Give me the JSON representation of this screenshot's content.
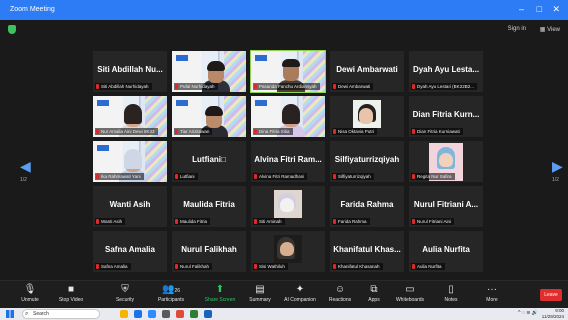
{
  "window": {
    "title": "Zoom Meeting",
    "minimize": "–",
    "maximize": "□",
    "close": "✕"
  },
  "topbar": {
    "sign_in": "Sign in",
    "view": "View"
  },
  "gallery": {
    "page_left": "1/2",
    "page_right": "1/2",
    "tiles": [
      {
        "name": "Siti Abdillah Nu...",
        "label": "Siti Abdillah Nurhidayah"
      },
      {
        "name": "",
        "label": "Pufal Nurhidayah"
      },
      {
        "name": "",
        "label": "Pasanda Fanchu Ardiansyah"
      },
      {
        "name": "Dewi Ambarwati",
        "label": "Dewi Ambarwati"
      },
      {
        "name": "Dyah Ayu Lesta...",
        "label": "Dyah Ayu Lestari (BK22B2..."
      },
      {
        "name": "",
        "label": "Nur Amalia Aini Dewi 8K33"
      },
      {
        "name": "",
        "label": "Tiar Arizitawan"
      },
      {
        "name": "",
        "label": "Dina Fitria Sitia"
      },
      {
        "name": "",
        "label": "Nisa Oktavia Putri"
      },
      {
        "name": "Dian Fitria Kurn...",
        "label": "Dian Fitria Kurniawati"
      },
      {
        "name": "",
        "label": "Ika Rahmawati Yani"
      },
      {
        "name": "Lutfiani□",
        "label": "Lutfiani"
      },
      {
        "name": "Alvina Fitri Ram...",
        "label": "Alvina Fitri Ramadhani"
      },
      {
        "name": "Silfiyaturrizqiyah",
        "label": "Silfiyaturrizqiyah"
      },
      {
        "name": "",
        "label": "Regita Nur Safira"
      },
      {
        "name": "Wanti Asih",
        "label": "Wanti Asih"
      },
      {
        "name": "Maulida Fitria",
        "label": "Maulida Fitria"
      },
      {
        "name": "",
        "label": "Siti Aminah"
      },
      {
        "name": "Farida Rahma",
        "label": "Farida Rahma"
      },
      {
        "name": "Nurul Fitriani A...",
        "label": "Nurul Fitriani Aini"
      },
      {
        "name": "Safna Amalia",
        "label": "Safna Amalia"
      },
      {
        "name": "Nurul Falikhah",
        "label": "Nurul Falikhah"
      },
      {
        "name": "",
        "label": "Sisi Wathiluh"
      },
      {
        "name": "Khanifatul Khas...",
        "label": "Khanifatul Khasanah"
      },
      {
        "name": "Aulia Nurfita",
        "label": "Aulia Nurfita"
      }
    ]
  },
  "toolbar": {
    "unmute": "Unmute",
    "stop_video": "Stop Video",
    "security": "Security",
    "participants": "Participants",
    "participants_count": "26",
    "share_screen": "Share Screen",
    "summary": "Summary",
    "ai_companion": "AI Companion",
    "reactions": "Reactions",
    "apps": "Apps",
    "whiteboards": "Whiteboards",
    "notes": "Notes",
    "more": "More",
    "leave": "Leave"
  },
  "taskbar": {
    "search_placeholder": "Search",
    "time": "9:00",
    "date": "11/29/2024"
  },
  "colors": {
    "accent": "#2d7cf6",
    "share": "#28c860",
    "leave": "#e02d2d",
    "active_speaker": "#8fd14f"
  }
}
